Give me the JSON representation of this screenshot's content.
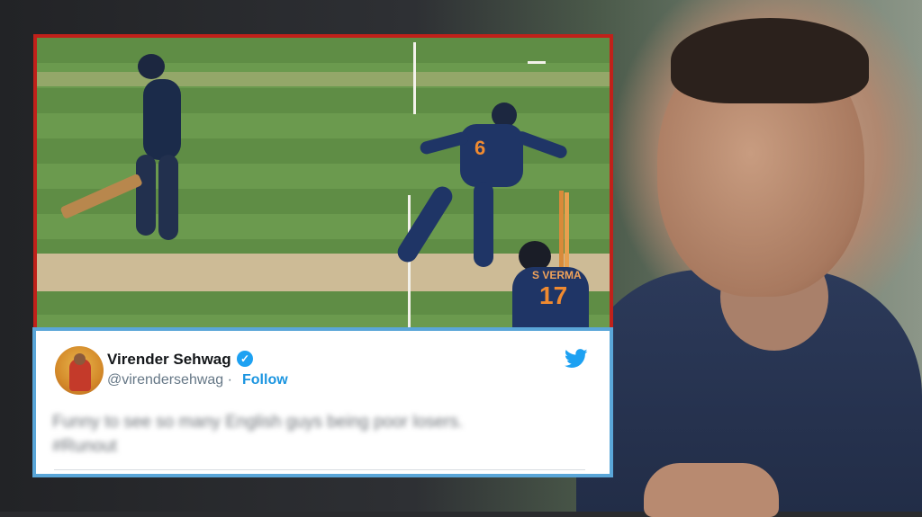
{
  "tweet": {
    "name": "Virender Sehwag",
    "verified_icon": "verified-badge-icon",
    "handle": "@virendersehwag",
    "separator": "·",
    "follow_label": "Follow",
    "brand_icon": "twitter-bird-icon",
    "text_line1": "Funny to see so many English guys being poor losers.",
    "text_line2": "#Runout"
  },
  "photo": {
    "jersey_bowler": "6",
    "jersey_keeper": "17",
    "keeper_name": "S VERMA"
  },
  "colors": {
    "photo_border": "#c0211a",
    "tweet_border": "#5aa6d8",
    "twitter_blue": "#1da1f2"
  }
}
